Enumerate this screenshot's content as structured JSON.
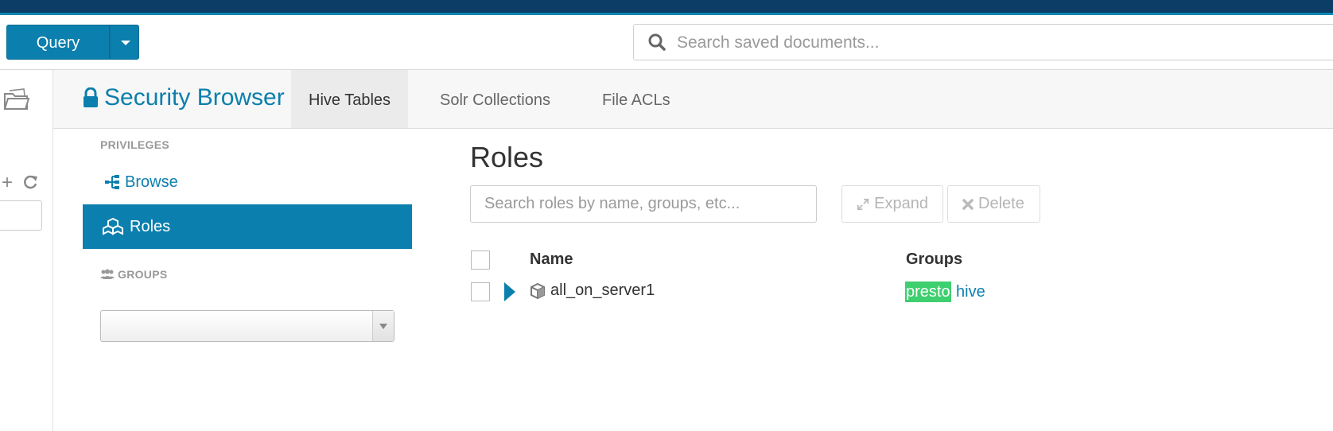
{
  "toolbar": {
    "query_label": "Query",
    "search_placeholder": "Search saved documents..."
  },
  "app": {
    "title": "Security Browser",
    "tabs": [
      {
        "label": "Hive Tables",
        "active": true
      },
      {
        "label": "Solr Collections",
        "active": false
      },
      {
        "label": "File ACLs",
        "active": false
      }
    ]
  },
  "sidebar": {
    "privileges_heading": "PRIVILEGES",
    "items": [
      {
        "label": "Browse",
        "active": false
      },
      {
        "label": "Roles",
        "active": true
      }
    ],
    "groups_heading": "GROUPS",
    "group_select_value": ""
  },
  "main": {
    "title": "Roles",
    "search_placeholder": "Search roles by name, groups, etc...",
    "expand_label": "Expand",
    "delete_label": "Delete",
    "columns": {
      "name": "Name",
      "groups": "Groups"
    },
    "rows": [
      {
        "name": "all_on_server1",
        "groups": [
          "presto",
          "hive"
        ]
      }
    ]
  },
  "colors": {
    "accent": "#0b7fad",
    "topbar": "#0b3d66",
    "highlight": "#3ecf6e"
  }
}
